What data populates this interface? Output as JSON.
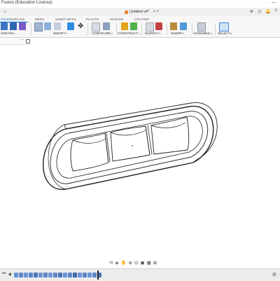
{
  "app": {
    "title": "Fusion (Education License)"
  },
  "tabs": {
    "file_tab_label": "Untitled v4*"
  },
  "workspace_tabs": [
    "SOLID",
    "SURFACE",
    "MESH",
    "SHEET METAL",
    "PLASTIC",
    "MANAGE",
    "UTILITIES"
  ],
  "toolbar_groups": [
    "CREATE",
    "MODIFY",
    "CONFIGURE",
    "CONSTRUCT",
    "INSPECT",
    "INSERT",
    "ASSEMBLE",
    "SELECT"
  ],
  "timeline": {
    "features": [
      {
        "icon": "sketch-feature-icon",
        "color": "#6a95d6"
      },
      {
        "icon": "extrude-feature-icon",
        "color": "#5f86c4"
      },
      {
        "icon": "sketch-feature-icon",
        "color": "#6a95d6"
      },
      {
        "icon": "extrude-feature-icon",
        "color": "#5f86c4"
      },
      {
        "icon": "fillet-feature-icon",
        "color": "#4a76b8"
      },
      {
        "icon": "sketch-feature-icon",
        "color": "#6a95d6"
      },
      {
        "icon": "extrude-feature-icon",
        "color": "#5f86c4"
      },
      {
        "icon": "sketch-feature-icon",
        "color": "#6a95d6"
      },
      {
        "icon": "extrude-feature-icon",
        "color": "#5f86c4"
      },
      {
        "icon": "fillet-feature-icon",
        "color": "#4a76b8"
      },
      {
        "icon": "sketch-feature-icon",
        "color": "#6a95d6"
      },
      {
        "icon": "extrude-feature-icon",
        "color": "#5f86c4"
      },
      {
        "icon": "chamfer-feature-icon",
        "color": "#3f6aa8"
      },
      {
        "icon": "sketch-feature-icon",
        "color": "#6a95d6"
      },
      {
        "icon": "extrude-feature-icon",
        "color": "#5f86c4"
      },
      {
        "icon": "sketch-feature-icon",
        "color": "#6a95d6"
      },
      {
        "icon": "extrude-feature-icon",
        "color": "#5f86c4"
      },
      {
        "icon": "fillet-feature-icon",
        "color": "#4a76b8"
      }
    ]
  },
  "colors": {
    "accent": "#0a74c7",
    "model_line": "#222222"
  }
}
